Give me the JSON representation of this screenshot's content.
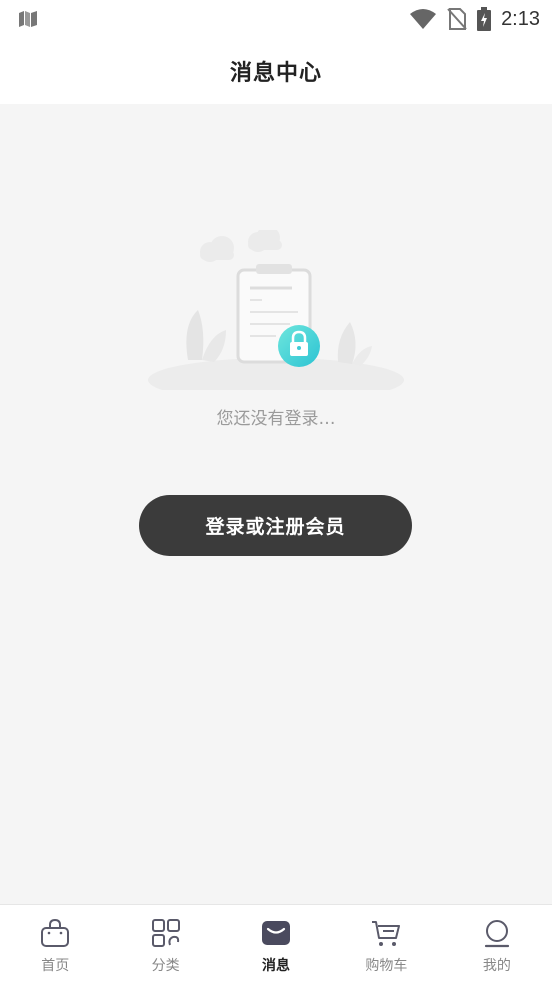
{
  "status_bar": {
    "time": "2:13"
  },
  "header": {
    "title": "消息中心"
  },
  "main": {
    "empty_text": "您还没有登录…",
    "login_button_label": "登录或注册会员"
  },
  "bottom_nav": {
    "active": "消息",
    "items": [
      {
        "label": "首页",
        "icon": "shopping-bag-icon"
      },
      {
        "label": "分类",
        "icon": "category-grid-icon"
      },
      {
        "label": "消息",
        "icon": "message-envelope-icon"
      },
      {
        "label": "购物车",
        "icon": "shopping-cart-icon"
      },
      {
        "label": "我的",
        "icon": "profile-icon"
      }
    ]
  },
  "colors": {
    "button_bg": "#3b3b3b",
    "accent_lock": "#3fd0d5",
    "active_icon": "#4a4a5e",
    "inactive_icon": "#5a5a6a"
  }
}
